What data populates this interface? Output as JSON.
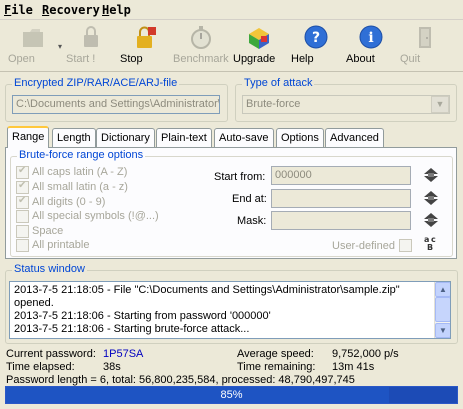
{
  "menu": [
    {
      "first": "F",
      "rest": "ile"
    },
    {
      "first": "R",
      "rest": "ecovery"
    },
    {
      "first": "H",
      "rest": "elp"
    }
  ],
  "toolbar": {
    "open": "Open",
    "start": "Start !",
    "stop": "Stop",
    "benchmark": "Benchmark",
    "upgrade": "Upgrade",
    "help": "Help",
    "about": "About",
    "quit": "Quit"
  },
  "file_group": {
    "title": "Encrypted ZIP/RAR/ACE/ARJ-file",
    "path": "C:\\Documents and Settings\\Administrator\\"
  },
  "attack_group": {
    "title": "Type of attack",
    "value": "Brute-force"
  },
  "tabs": [
    "Range",
    "Length",
    "Dictionary",
    "Plain-text",
    "Auto-save",
    "Options",
    "Advanced"
  ],
  "range": {
    "title": "Brute-force range options",
    "options": [
      {
        "label": "All caps latin (A - Z)",
        "checked": true
      },
      {
        "label": "All small latin (a - z)",
        "checked": true
      },
      {
        "label": "All digits (0 - 9)",
        "checked": true
      },
      {
        "label": "All special symbols (!@...)",
        "checked": false
      },
      {
        "label": "Space",
        "checked": false
      },
      {
        "label": "All printable",
        "checked": false
      }
    ],
    "start_from_label": "Start from:",
    "start_from_value": "000000",
    "end_at_label": "End at:",
    "end_at_value": "",
    "mask_label": "Mask:",
    "mask_value": "",
    "user_defined_label": "User-defined"
  },
  "status": {
    "title": "Status window",
    "lines": [
      "2013-7-5 21:18:05 - File \"C:\\Documents and Settings\\Administrator\\sample.zip\"",
      "opened.",
      "2013-7-5 21:18:06 - Starting from password '000000'",
      "2013-7-5 21:18:06 - Starting brute-force attack..."
    ]
  },
  "stats": {
    "current_password_label": "Current password:",
    "current_password_value": "1P57SA",
    "average_speed_label": "Average speed:",
    "average_speed_value": "9,752,000 p/s",
    "time_elapsed_label": "Time elapsed:",
    "time_elapsed_value": "38s",
    "time_remaining_label": "Time remaining:",
    "time_remaining_value": "13m 41s",
    "summary": "Password length = 6, total: 56,800,235,584, processed: 48,790,497,745"
  },
  "progress": {
    "percent": 85,
    "label": "85%"
  },
  "colors": {
    "accent_blue": "#0046d5",
    "progress_blue": "#1e54c3",
    "tab_highlight": "#ffc83c"
  }
}
